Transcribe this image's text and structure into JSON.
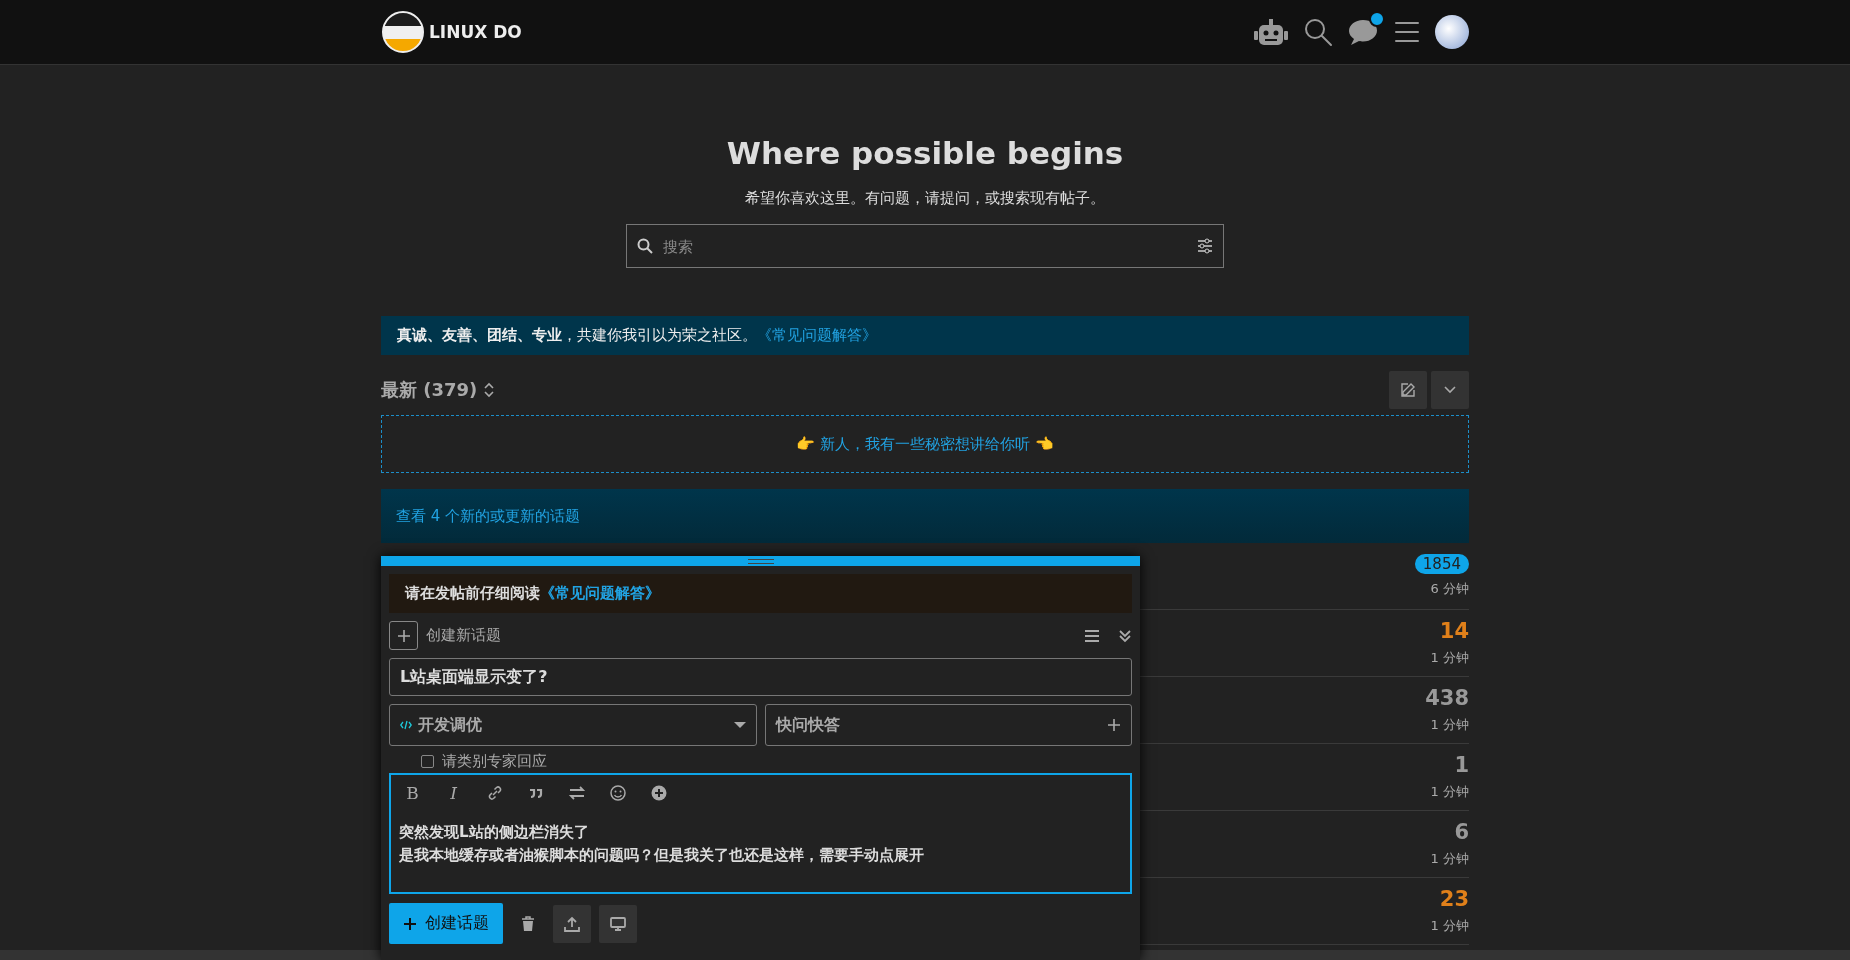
{
  "header": {
    "site_title": "LINUX DO",
    "notifications_unread": true
  },
  "hero": {
    "title": "Where possible begins",
    "subtitle": "希望你喜欢这里。有问题，请提问，或搜索现有帖子。",
    "search": {
      "placeholder": "搜索"
    }
  },
  "banner": {
    "text": "**真诚、友善、团结、专业**，共建你我引以为荣之社区。",
    "link": "《常见问题解答》"
  },
  "list_header": {
    "title": "最新 (379)"
  },
  "promo": {
    "text": "👉 新人，我有一些秘密想讲给你听 👈"
  },
  "new_topics": {
    "text": "查看 4 个新的或更新的话题"
  },
  "topics": [
    {
      "kind": "badge",
      "replies": "1854",
      "activity": "6 分钟"
    },
    {
      "kind": "hot",
      "replies": "14",
      "activity": "1 分钟"
    },
    {
      "kind": "normal",
      "replies": "438",
      "activity": "1 分钟"
    },
    {
      "kind": "normal",
      "replies": "1",
      "activity": "1 分钟"
    },
    {
      "kind": "normal",
      "replies": "6",
      "activity": "1 分钟"
    },
    {
      "kind": "hot",
      "replies": "23",
      "activity": "1 分钟"
    }
  ],
  "composer": {
    "notice": "请在发帖前仔细阅读",
    "notice_link": "《常见问题解答》",
    "action": "创建新话题",
    "title_value": "L站桌面端显示变了?",
    "category": "开发调优",
    "tags": "快问快答",
    "expert_checkbox": {
      "label": "请类别专家回应",
      "checked": false
    },
    "toolbar": [
      {
        "kind": "bold",
        "glyph": "B"
      },
      {
        "kind": "italic",
        "glyph": "I"
      },
      {
        "kind": "link"
      },
      {
        "kind": "quote"
      },
      {
        "kind": "swap"
      },
      {
        "kind": "emoji"
      },
      {
        "kind": "add"
      }
    ],
    "body_lines": [
      "突然发现L站的侧边栏消失了",
      "是我本地缓存或者油猴脚本的问题吗？但是我关了也还是这样，需要手动点展开"
    ],
    "submit": "创建话题"
  }
}
